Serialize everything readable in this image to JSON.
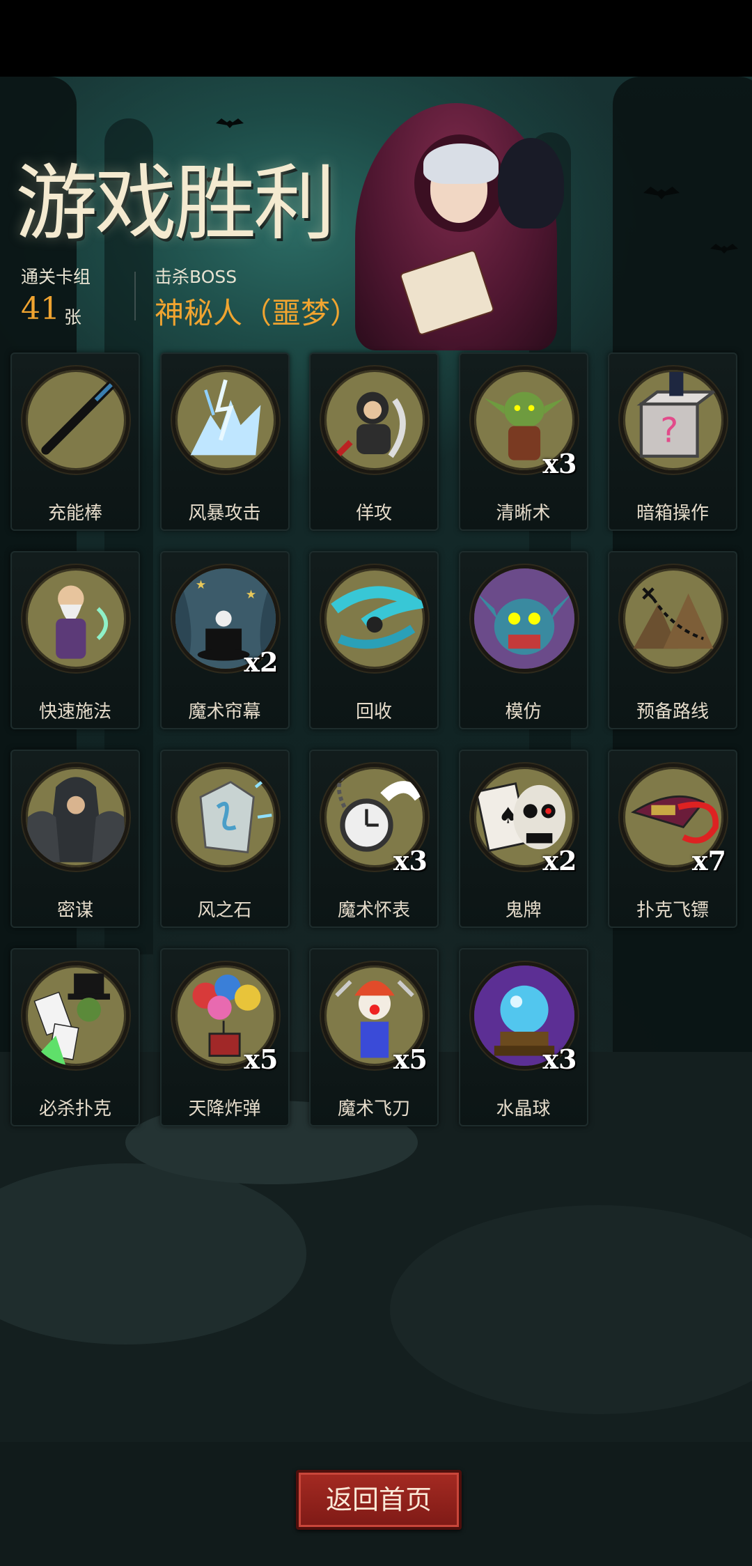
{
  "title": "游戏胜利",
  "stats": {
    "deck_label": "通关卡组",
    "deck_count": "41",
    "deck_unit": "张",
    "boss_label": "击杀BOSS",
    "boss_name": "神秘人（噩梦）"
  },
  "cards": [
    {
      "name": "充能棒",
      "count": "",
      "icon": "wand-icon"
    },
    {
      "name": "风暴攻击",
      "count": "",
      "icon": "lightning-storm-icon"
    },
    {
      "name": "佯攻",
      "count": "",
      "icon": "feint-swordsman-icon"
    },
    {
      "name": "清晰术",
      "count": "x3",
      "icon": "goblin-icon"
    },
    {
      "name": "暗箱操作",
      "count": "",
      "icon": "mystery-box-icon"
    },
    {
      "name": "快速施法",
      "count": "",
      "icon": "old-wizard-icon"
    },
    {
      "name": "魔术帘幕",
      "count": "x2",
      "icon": "magic-curtain-hat-icon"
    },
    {
      "name": "回收",
      "count": "",
      "icon": "swirl-icon"
    },
    {
      "name": "模仿",
      "count": "",
      "icon": "troll-face-icon"
    },
    {
      "name": "预备路线",
      "count": "",
      "icon": "treasure-map-icon"
    },
    {
      "name": "密谋",
      "count": "",
      "icon": "hooded-conspirators-icon"
    },
    {
      "name": "风之石",
      "count": "",
      "icon": "wind-stone-icon"
    },
    {
      "name": "魔术怀表",
      "count": "x3",
      "icon": "pocket-watch-icon"
    },
    {
      "name": "鬼牌",
      "count": "x2",
      "icon": "skull-joker-icon"
    },
    {
      "name": "扑克飞镖",
      "count": "x7",
      "icon": "flying-card-icon"
    },
    {
      "name": "必杀扑克",
      "count": "",
      "icon": "magician-cards-icon"
    },
    {
      "name": "天降炸弹",
      "count": "x5",
      "icon": "balloon-bomb-icon"
    },
    {
      "name": "魔术飞刀",
      "count": "x5",
      "icon": "clown-knives-icon"
    },
    {
      "name": "水晶球",
      "count": "x3",
      "icon": "crystal-ball-icon"
    }
  ],
  "footer": {
    "home_label": "返回首页"
  },
  "colors": {
    "accent": "#f0a430",
    "button_red": "#a52a22",
    "disc": "#807a49"
  }
}
